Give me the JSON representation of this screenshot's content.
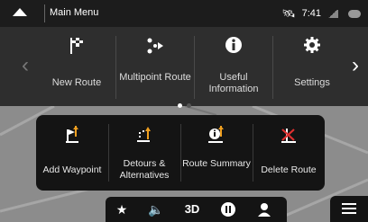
{
  "header": {
    "title": "Main Menu",
    "time": "7:41"
  },
  "main_menu": {
    "items": [
      {
        "label": "New Route",
        "icon": "checkered-flag-icon"
      },
      {
        "label": "Multipoint Route",
        "icon": "multipoint-icon"
      },
      {
        "label": "Useful Information",
        "icon": "info-icon"
      },
      {
        "label": "Settings",
        "icon": "gear-icon"
      }
    ]
  },
  "route_menu": {
    "items": [
      {
        "label": "Add Waypoint",
        "icon": "add-waypoint-icon"
      },
      {
        "label": "Detours & Alternatives",
        "icon": "detour-icon"
      },
      {
        "label": "Route Summary",
        "icon": "route-summary-icon"
      },
      {
        "label": "Delete Route",
        "icon": "delete-route-icon"
      }
    ]
  },
  "bottom_bar": {
    "view_mode": "3D"
  },
  "colors": {
    "accent": "#f0a020",
    "delete": "#e03030",
    "panel": "#141414"
  }
}
